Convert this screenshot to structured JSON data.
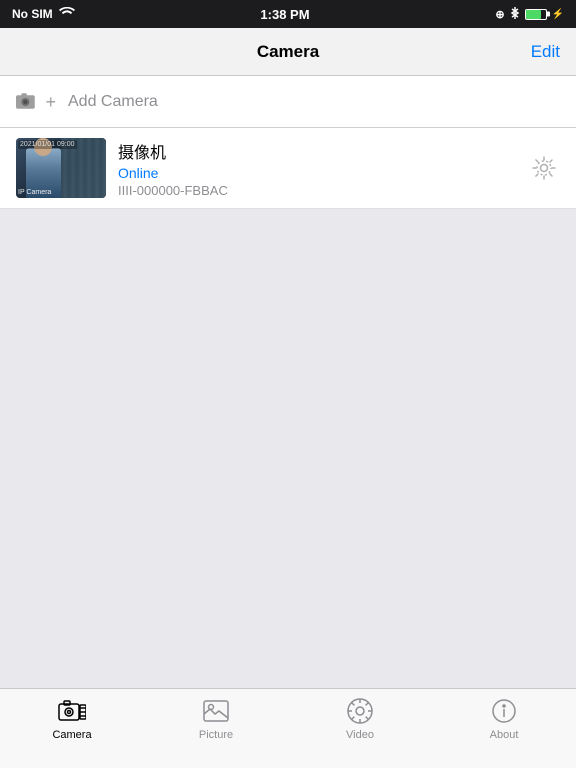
{
  "statusBar": {
    "carrier": "No SIM",
    "time": "1:38 PM"
  },
  "navBar": {
    "title": "Camera",
    "editLabel": "Edit"
  },
  "addCamera": {
    "label": "Add Camera"
  },
  "cameras": [
    {
      "name": "摄像机",
      "status": "Online",
      "id": "IIII-000000-FBBAC",
      "timestamp": "2021/01/01 09:00"
    }
  ],
  "tabs": [
    {
      "id": "camera",
      "label": "Camera",
      "active": true
    },
    {
      "id": "picture",
      "label": "Picture",
      "active": false
    },
    {
      "id": "video",
      "label": "Video",
      "active": false
    },
    {
      "id": "about",
      "label": "About",
      "active": false
    }
  ]
}
